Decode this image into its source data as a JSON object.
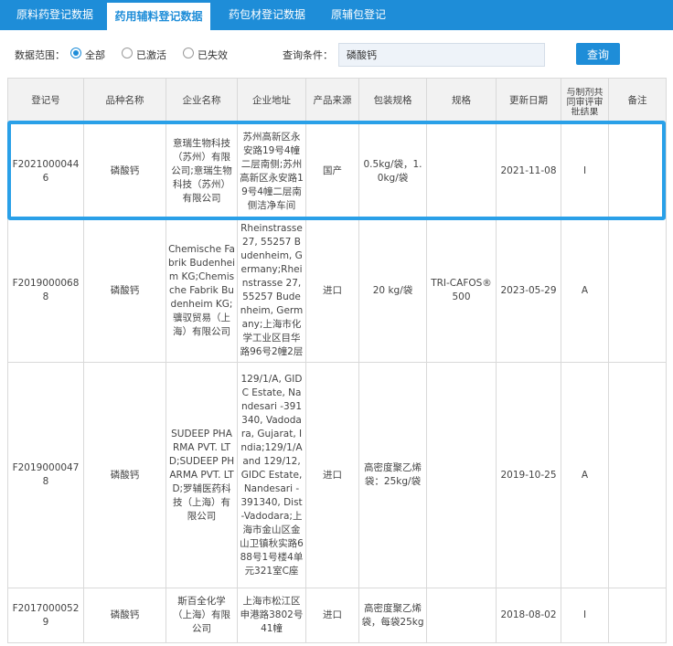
{
  "tabs": [
    {
      "label": "原料药登记数据"
    },
    {
      "label": "药用辅料登记数据"
    },
    {
      "label": "药包材登记数据"
    },
    {
      "label": "原辅包登记"
    }
  ],
  "filter": {
    "scope_label": "数据范围：",
    "options": [
      {
        "label": "全部",
        "checked": true
      },
      {
        "label": "已激活",
        "checked": false
      },
      {
        "label": "已失效",
        "checked": false
      }
    ],
    "condition_label": "查询条件：",
    "query_value": "磷酸钙",
    "query_button": "查询"
  },
  "table": {
    "headers": [
      "登记号",
      "品种名称",
      "企业名称",
      "企业地址",
      "产品来源",
      "包装规格",
      "规格",
      "更新日期",
      "与制剂共同审评审批结果",
      "备注"
    ],
    "rows": [
      {
        "reg_no": "F20210000446",
        "name": "磷酸钙",
        "company": "意瑞生物科技（苏州）有限公司;意瑞生物科技（苏州）有限公司",
        "address": "苏州高新区永安路19号4幢二层南侧;苏州高新区永安路19号4幢二层南侧洁净车间",
        "source": "国产",
        "package": "0.5kg/袋，1.0kg/袋",
        "spec": "",
        "date": "2021-11-08",
        "result": "I",
        "remark": ""
      },
      {
        "reg_no": "F20190000688",
        "name": "磷酸钙",
        "company": "Chemische Fabrik Budenheim KG;Chemische Fabrik Budenheim KG;骥驭贸易（上海）有限公司",
        "address": "Rheinstrasse 27, 55257 Budenheim, Germany;Rheinstrasse 27, 55257 Budenheim, Germany;上海市化学工业区目华路96号2幢2层",
        "source": "进口",
        "package": "20 kg/袋",
        "spec": "TRI-CAFOS® 500",
        "date": "2023-05-29",
        "result": "A",
        "remark": ""
      },
      {
        "reg_no": "F20190000478",
        "name": "磷酸钙",
        "company": "SUDEEP PHARMA PVT. LTD;SUDEEP PHARMA PVT. LTD;罗辅医药科技（上海）有限公司",
        "address": "129/1/A, GIDC Estate, Nandesari -391340, Vadodara, Gujarat, India;129/1/A and 129/12, GIDC Estate, Nandesari - 391340, Dist -Vadodara;上海市金山区金山卫镇秋实路688号1号楼4单元321室C座",
        "source": "进口",
        "package": "高密度聚乙烯袋：25kg/袋",
        "spec": "",
        "date": "2019-10-25",
        "result": "A",
        "remark": ""
      },
      {
        "reg_no": "F20170000529",
        "name": "磷酸钙",
        "company": "斯百全化学（上海）有限公司",
        "address": "上海市松江区申港路3802号41幢",
        "source": "进口",
        "package": "高密度聚乙烯袋，每袋25kg",
        "spec": "",
        "date": "2018-08-02",
        "result": "I",
        "remark": ""
      }
    ]
  },
  "colors": {
    "tab_bar": "#1e8dd8",
    "button": "#1e8dd8",
    "highlight_border": "#2aa0e8",
    "header_bg": "#f2f2f2"
  }
}
